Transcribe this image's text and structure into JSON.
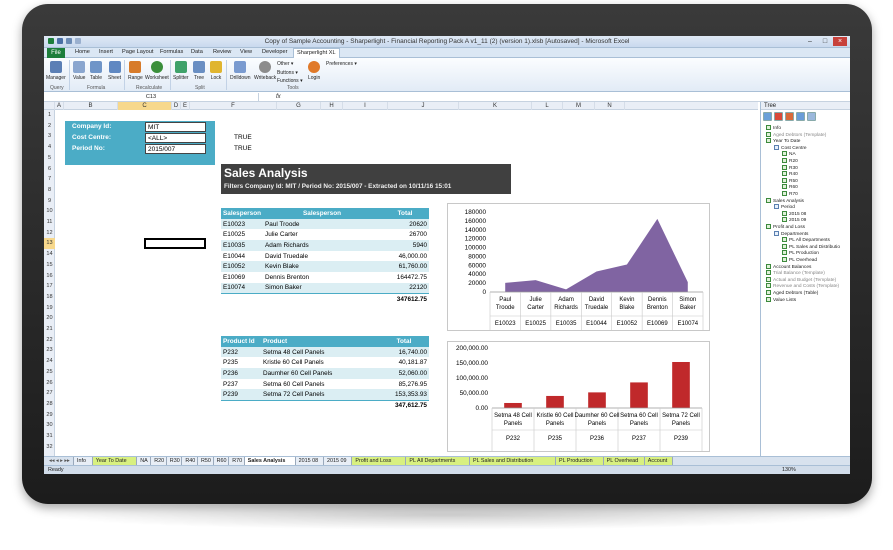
{
  "window": {
    "title": "Copy of Sample Accounting - Sharperlight - Financial Reporting Pack A v1_11 (2) (version 1).xlsb [Autosaved] - Microsoft Excel"
  },
  "menu": {
    "file": "File",
    "tabs": [
      "Home",
      "Insert",
      "Page Layout",
      "Formulas",
      "Data",
      "Review",
      "View",
      "Developer",
      "Sharperlight XL"
    ]
  },
  "ribbon": {
    "groups": {
      "query": "Query",
      "formula": "Formula",
      "recalculate": "Recalculate",
      "split": "Split",
      "tools": "Tools"
    },
    "buttons": [
      "Manager",
      "Value",
      "Table",
      "Sheet",
      "Range",
      "Worksheet",
      "Splitter",
      "Tree",
      "Lock",
      "Drilldown",
      "Writeback",
      "Login"
    ],
    "small": [
      "Other",
      "Buttons",
      "Functions",
      "Preferences"
    ]
  },
  "formula_bar": {
    "name_box": "C13",
    "fx": "fx"
  },
  "columns": [
    "A",
    "B",
    "C",
    "D",
    "E",
    "F",
    "G",
    "H",
    "I",
    "J",
    "K",
    "L",
    "M",
    "N"
  ],
  "rows": [
    "1",
    "2",
    "3",
    "4",
    "5",
    "6",
    "7",
    "8",
    "9",
    "10",
    "11",
    "12",
    "13",
    "14",
    "15",
    "16",
    "17",
    "18",
    "19",
    "20",
    "21",
    "22",
    "23",
    "24",
    "25",
    "26",
    "27",
    "28",
    "29",
    "30",
    "31",
    "32"
  ],
  "selected_cell": {
    "column": "C",
    "row": "13"
  },
  "params": {
    "company_label": "Company Id:",
    "company_value": "MIT",
    "cost_label": "Cost Centre:",
    "cost_value": "<ALL>",
    "period_label": "Period No:",
    "period_value": "2015/007",
    "true1": "TRUE",
    "true2": "TRUE"
  },
  "banner": {
    "title": "Sales Analysis",
    "subtitle": "Filters   Company Id: MIT  /  Period No: 2015/007 - Extracted on 10/11/16 15:01"
  },
  "sales_table": {
    "headers": [
      "Salesperson",
      "Salesperson",
      "Total"
    ],
    "rows": [
      [
        "E10023",
        "Paul Troode",
        "20620"
      ],
      [
        "E10025",
        "Julie Carter",
        "26700"
      ],
      [
        "E10035",
        "Adam Richards",
        "5940"
      ],
      [
        "E10044",
        "David Truedale",
        "46,000.00"
      ],
      [
        "E10052",
        "Kevin Blake",
        "61,760.00"
      ],
      [
        "E10069",
        "Dennis Brenton",
        "164472.75"
      ],
      [
        "E10074",
        "Simon Baker",
        "22120"
      ]
    ],
    "total": "347612.75"
  },
  "product_table": {
    "headers": [
      "Product Id",
      "Product",
      "Total"
    ],
    "rows": [
      [
        "P232",
        "Setma 48 Cell Panels",
        "16,740.00"
      ],
      [
        "P235",
        "Kristle 60 Cell Panels",
        "40,181.87"
      ],
      [
        "P236",
        "Daumher 60 Cell Panels",
        "52,060.00"
      ],
      [
        "P237",
        "Setma 60 Cell Panels",
        "85,276.95"
      ],
      [
        "P239",
        "Setma 72 Cell Panels",
        "153,353.93"
      ]
    ],
    "total": "347,612.75"
  },
  "chart_data": [
    {
      "type": "area",
      "categories": [
        "Paul Troode",
        "Julie Carter",
        "Adam Richards",
        "David Truedale",
        "Kevin Blake",
        "Dennis Brenton",
        "Simon Baker"
      ],
      "ids": [
        "E10023",
        "E10025",
        "E10035",
        "E10044",
        "E10052",
        "E10069",
        "E10074"
      ],
      "values": [
        20620,
        26700,
        5940,
        46000,
        61760,
        164472.75,
        22120
      ],
      "yticks": [
        "180000",
        "160000",
        "140000",
        "120000",
        "100000",
        "80000",
        "60000",
        "40000",
        "20000",
        "0"
      ],
      "ylim": [
        0,
        180000
      ],
      "color": "#8064a2",
      "title": "",
      "xlabel": "",
      "ylabel": ""
    },
    {
      "type": "bar",
      "categories": [
        "Setma 48 Cell Panels",
        "Kristle 60 Cell Panels",
        "Daumher 60 Cell Panels",
        "Setma 60 Cell Panels",
        "Setma 72 Cell Panels"
      ],
      "ids": [
        "P232",
        "P235",
        "P236",
        "P237",
        "P239"
      ],
      "values": [
        16740,
        40181.87,
        52060,
        85276.95,
        153353.93
      ],
      "yticks": [
        "200,000.00",
        "150,000.00",
        "100,000.00",
        "50,000.00",
        "0.00"
      ],
      "ylim": [
        0,
        200000
      ],
      "color": "#c0292b",
      "title": "",
      "xlabel": "",
      "ylabel": ""
    }
  ],
  "sheet_tabs": [
    "Info",
    "Year To Date",
    "NA",
    "R20",
    "R30",
    "R40",
    "R50",
    "R60",
    "R70",
    "Sales Analysis",
    "2015 08",
    "2015 09",
    "Profit and Loss",
    "PL All Departments",
    "PL Sales and Distribution",
    "PL Production",
    "PL Overhead",
    "Account"
  ],
  "status": {
    "ready": "Ready",
    "zoom": "130%"
  },
  "tree": {
    "header": "Tree",
    "nodes": [
      {
        "t": "Info",
        "d": 0,
        "g": false
      },
      {
        "t": "Aged Debtors (Template)",
        "d": 0,
        "g": true
      },
      {
        "t": "Year To Date",
        "d": 0,
        "g": false
      },
      {
        "t": "Cost Centre",
        "d": 1,
        "g": false
      },
      {
        "t": "NA",
        "d": 2,
        "g": false
      },
      {
        "t": "R20",
        "d": 2,
        "g": false
      },
      {
        "t": "R30",
        "d": 2,
        "g": false
      },
      {
        "t": "R40",
        "d": 2,
        "g": false
      },
      {
        "t": "R50",
        "d": 2,
        "g": false
      },
      {
        "t": "R60",
        "d": 2,
        "g": false
      },
      {
        "t": "R70",
        "d": 2,
        "g": false
      },
      {
        "t": "Sales Analysis",
        "d": 0,
        "g": false
      },
      {
        "t": "Period",
        "d": 1,
        "g": false
      },
      {
        "t": "2015 08",
        "d": 2,
        "g": false
      },
      {
        "t": "2015 09",
        "d": 2,
        "g": false
      },
      {
        "t": "Profit and Loss",
        "d": 0,
        "g": false
      },
      {
        "t": "Departments",
        "d": 1,
        "g": false
      },
      {
        "t": "PL All Departments",
        "d": 2,
        "g": false
      },
      {
        "t": "PL Sales and Distributio",
        "d": 2,
        "g": false
      },
      {
        "t": "PL Production",
        "d": 2,
        "g": false
      },
      {
        "t": "PL Overhead",
        "d": 2,
        "g": false
      },
      {
        "t": "Account Balances",
        "d": 0,
        "g": false
      },
      {
        "t": "Trial Balance (Template)",
        "d": 0,
        "g": true
      },
      {
        "t": "Actual and Budget (Template)",
        "d": 0,
        "g": true
      },
      {
        "t": "Revenue and Costs (Template)",
        "d": 0,
        "g": true
      },
      {
        "t": "Aged Debtors (Table)",
        "d": 0,
        "g": false
      },
      {
        "t": "Value Lists",
        "d": 0,
        "g": false
      }
    ]
  }
}
